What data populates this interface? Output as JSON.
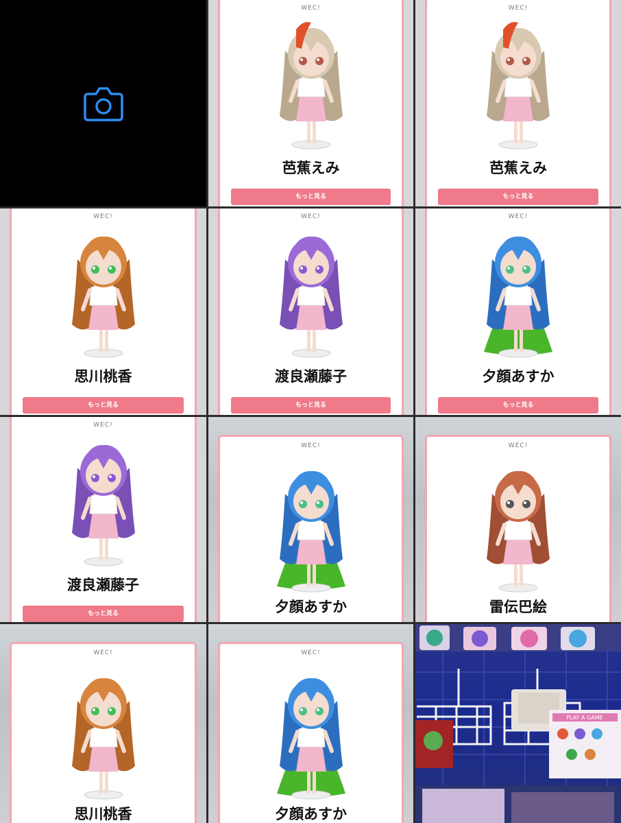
{
  "cards": [
    {
      "id": "emi-1",
      "name": "芭蕉えみ",
      "tag": "WEC!",
      "button": "もっと見る",
      "hair": "#d8c9b0",
      "hair_dark": "#b9a88d",
      "streak": "#e2502a",
      "eyes": "#b05a4a",
      "skirt": "#f2b6cd"
    },
    {
      "id": "emi-2",
      "name": "芭蕉えみ",
      "tag": "WEC!",
      "button": "もっと見る",
      "hair": "#d8c9b0",
      "hair_dark": "#b9a88d",
      "streak": "#e2502a",
      "eyes": "#b05a4a",
      "skirt": "#f2b6cd"
    },
    {
      "id": "momoka-1",
      "name": "思川桃香",
      "tag": "WEC!",
      "button": "もっと見る",
      "hair": "#d7853e",
      "hair_dark": "#b46528",
      "eyes": "#3fbf5a",
      "skirt": "#f2b6cd"
    },
    {
      "id": "fujiko-1",
      "name": "渡良瀬藤子",
      "tag": "WEC!",
      "button": "もっと見る",
      "hair": "#9b6ad6",
      "hair_dark": "#7a4fb6",
      "eyes": "#8c5ad0",
      "skirt": "#f2b6cd"
    },
    {
      "id": "asuka-1",
      "name": "夕顔あすか",
      "tag": "WEC!",
      "button": "もっと見る",
      "hair": "#3e8ee0",
      "hair_dark": "#2b6ec0",
      "eyes": "#4bbf8a",
      "cape": "#49b52a",
      "skirt": "#f2b6cd"
    },
    {
      "id": "fujiko-2",
      "name": "渡良瀬藤子",
      "tag": "WEC!",
      "button": "もっと見る",
      "hair": "#9b6ad6",
      "hair_dark": "#7a4fb6",
      "eyes": "#8c5ad0",
      "skirt": "#f2b6cd"
    },
    {
      "id": "asuka-2",
      "name": "夕顔あすか",
      "tag": "WEC!",
      "button": "",
      "hair": "#3e8ee0",
      "hair_dark": "#2b6ec0",
      "eyes": "#4bbf8a",
      "cape": "#49b52a",
      "skirt": "#f2b6cd"
    },
    {
      "id": "tomoe-1",
      "name": "雷伝巴絵",
      "tag": "WEC!",
      "button": "",
      "hair": "#c76a48",
      "hair_dark": "#a04e34",
      "eyes": "#555555",
      "skirt": "#f2b6cd"
    },
    {
      "id": "momoka-2",
      "name": "思川桃香",
      "tag": "WEC!",
      "button": "",
      "hair": "#d7853e",
      "hair_dark": "#b46528",
      "eyes": "#3fbf5a",
      "skirt": "#f2b6cd"
    },
    {
      "id": "asuka-3",
      "name": "夕顔あすか",
      "tag": "WEC!",
      "button": "",
      "hair": "#3e8ee0",
      "hair_dark": "#2b6ec0",
      "eyes": "#4bbf8a",
      "cape": "#49b52a",
      "skirt": "#f2b6cd"
    }
  ],
  "camera": {
    "icon": "camera-icon",
    "color": "#2f8cf0"
  },
  "photo": {
    "icon": "merch-photo",
    "sign_text": "PLAY A GAME",
    "accent": "#2433a0"
  }
}
